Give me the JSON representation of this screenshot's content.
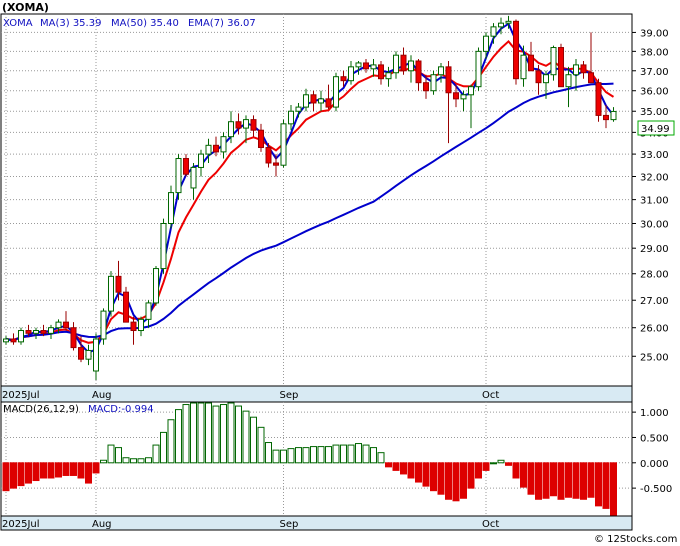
{
  "chart_data": [
    {
      "type": "candlestick",
      "title": "(XOMA)",
      "legend": [
        {
          "label": "XOMA",
          "color": "#0000cc"
        },
        {
          "label": "MA(3)",
          "value": "35.39",
          "color": "#0000cc"
        },
        {
          "label": "MA(50)",
          "value": "35.40",
          "color": "#0000cc"
        },
        {
          "label": "EMA(7)",
          "value": "36.07",
          "color": "#0000cc"
        }
      ],
      "x_ticks": [
        "2025Jul",
        "Aug",
        "Sep",
        "Oct"
      ],
      "y_ticks": [
        "25.00",
        "26.00",
        "27.00",
        "28.00",
        "29.00",
        "30.00",
        "31.00",
        "32.00",
        "33.00",
        "34.00",
        "35.00",
        "36.00",
        "37.00",
        "38.00",
        "39.00"
      ],
      "ylim": [
        24,
        40
      ],
      "y_scale": "log",
      "last_price": "34.99",
      "grid": true,
      "candles": [
        [
          25.5,
          25.7,
          25.4,
          25.6
        ],
        [
          25.6,
          25.8,
          25.4,
          25.5
        ],
        [
          25.5,
          26.0,
          25.4,
          25.9
        ],
        [
          25.9,
          26.1,
          25.7,
          25.8
        ],
        [
          25.8,
          26.0,
          25.6,
          25.9
        ],
        [
          25.9,
          26.1,
          25.7,
          25.8
        ],
        [
          25.8,
          26.1,
          25.6,
          26.0
        ],
        [
          26.0,
          26.3,
          25.8,
          26.2
        ],
        [
          26.2,
          26.6,
          25.9,
          26.0
        ],
        [
          26.0,
          26.2,
          25.2,
          25.3
        ],
        [
          25.3,
          25.7,
          24.8,
          24.9
        ],
        [
          24.9,
          25.4,
          24.7,
          25.2
        ],
        [
          24.5,
          25.8,
          24.2,
          25.6
        ],
        [
          25.6,
          26.7,
          25.4,
          26.6
        ],
        [
          26.6,
          28.1,
          26.4,
          27.9
        ],
        [
          27.9,
          28.5,
          27.0,
          27.3
        ],
        [
          27.3,
          27.5,
          26.4,
          26.2
        ],
        [
          26.2,
          26.4,
          25.4,
          25.9
        ],
        [
          25.9,
          26.4,
          25.7,
          26.3
        ],
        [
          26.3,
          27.0,
          26.0,
          26.9
        ],
        [
          26.9,
          28.3,
          26.8,
          28.2
        ],
        [
          28.2,
          30.2,
          28.0,
          30.0
        ],
        [
          30.0,
          31.6,
          29.8,
          31.3
        ],
        [
          31.3,
          33.0,
          31.0,
          32.8
        ],
        [
          32.8,
          33.0,
          32.0,
          32.1
        ],
        [
          31.5,
          32.6,
          31.0,
          32.4
        ],
        [
          32.4,
          33.2,
          32.0,
          33.0
        ],
        [
          33.0,
          33.7,
          32.6,
          33.4
        ],
        [
          33.4,
          33.8,
          32.9,
          33.1
        ],
        [
          33.1,
          34.0,
          32.8,
          33.8
        ],
        [
          33.8,
          35.0,
          33.5,
          34.5
        ],
        [
          34.5,
          34.9,
          33.9,
          34.2
        ],
        [
          34.2,
          34.8,
          33.5,
          34.6
        ],
        [
          34.6,
          34.8,
          33.8,
          34.1
        ],
        [
          34.1,
          34.4,
          33.1,
          33.3
        ],
        [
          33.3,
          33.5,
          32.4,
          32.6
        ],
        [
          32.6,
          33.0,
          32.0,
          32.5
        ],
        [
          32.5,
          34.6,
          32.4,
          34.4
        ],
        [
          34.4,
          35.3,
          34.1,
          35.0
        ],
        [
          35.0,
          35.4,
          34.7,
          35.2
        ],
        [
          35.2,
          36.1,
          35.0,
          35.8
        ],
        [
          35.8,
          36.0,
          35.0,
          35.4
        ],
        [
          35.4,
          36.0,
          35.0,
          35.6
        ],
        [
          35.6,
          36.3,
          35.1,
          35.2
        ],
        [
          35.2,
          36.9,
          35.0,
          36.7
        ],
        [
          36.7,
          37.0,
          36.2,
          36.5
        ],
        [
          36.5,
          37.5,
          36.3,
          37.2
        ],
        [
          37.2,
          37.5,
          36.8,
          37.4
        ],
        [
          37.4,
          37.6,
          36.9,
          37.1
        ],
        [
          37.1,
          37.6,
          36.7,
          37.3
        ],
        [
          37.3,
          37.5,
          36.3,
          36.6
        ],
        [
          36.6,
          37.2,
          36.2,
          36.9
        ],
        [
          36.9,
          38.0,
          36.6,
          37.8
        ],
        [
          37.8,
          38.2,
          36.8,
          37.0
        ],
        [
          37.0,
          37.8,
          36.4,
          37.5
        ],
        [
          37.5,
          37.6,
          36.0,
          36.4
        ],
        [
          36.4,
          36.8,
          35.6,
          36.0
        ],
        [
          36.0,
          37.0,
          35.8,
          36.8
        ],
        [
          36.8,
          37.4,
          36.4,
          37.2
        ],
        [
          37.2,
          37.5,
          33.5,
          35.9
        ],
        [
          35.9,
          36.3,
          35.2,
          35.6
        ],
        [
          35.6,
          36.0,
          35.0,
          35.8
        ],
        [
          35.8,
          36.3,
          34.2,
          36.2
        ],
        [
          36.2,
          38.2,
          36.0,
          38.0
        ],
        [
          38.0,
          39.0,
          37.6,
          38.8
        ],
        [
          38.8,
          39.5,
          38.4,
          39.3
        ],
        [
          39.3,
          39.8,
          38.9,
          39.5
        ],
        [
          39.5,
          39.9,
          39.2,
          39.6
        ],
        [
          39.6,
          39.7,
          36.3,
          36.6
        ],
        [
          36.6,
          38.3,
          36.2,
          37.8
        ],
        [
          37.8,
          38.5,
          37.2,
          37.0
        ],
        [
          37.0,
          37.3,
          35.8,
          36.4
        ],
        [
          36.4,
          37.0,
          35.6,
          36.8
        ],
        [
          36.8,
          38.3,
          36.5,
          38.2
        ],
        [
          38.2,
          38.4,
          36.4,
          36.2
        ],
        [
          36.2,
          37.2,
          35.2,
          36.8
        ],
        [
          36.8,
          37.6,
          36.0,
          37.3
        ],
        [
          37.3,
          37.5,
          36.6,
          36.9
        ],
        [
          36.9,
          39.0,
          36.4,
          36.4
        ],
        [
          36.4,
          36.6,
          34.5,
          34.8
        ],
        [
          34.8,
          35.3,
          34.2,
          34.6
        ],
        [
          34.6,
          35.2,
          34.5,
          34.99
        ]
      ]
    },
    {
      "type": "bar",
      "title": "MACD(26,12,9)",
      "legend": [
        {
          "label": "MACD:",
          "value": "-0.994",
          "color": "#0000cc"
        }
      ],
      "x_ticks": [
        "2025Jul",
        "Aug",
        "Sep",
        "Oct"
      ],
      "y_ticks": [
        "1.000",
        "0.500",
        "0.000",
        "-0.500"
      ],
      "ylim": [
        -1.05,
        1.2
      ],
      "grid": true,
      "colors": {
        "positive": "#006600",
        "negative": "#dd0000"
      },
      "values": [
        -0.55,
        -0.5,
        -0.45,
        -0.4,
        -0.35,
        -0.3,
        -0.3,
        -0.28,
        -0.25,
        -0.25,
        -0.3,
        -0.4,
        -0.2,
        0.05,
        0.35,
        0.3,
        0.1,
        0.08,
        0.08,
        0.1,
        0.35,
        0.6,
        0.85,
        1.05,
        1.15,
        1.18,
        1.18,
        1.18,
        1.12,
        1.15,
        1.18,
        1.12,
        1.02,
        0.9,
        0.7,
        0.4,
        0.25,
        0.25,
        0.28,
        0.3,
        0.3,
        0.32,
        0.32,
        0.32,
        0.35,
        0.35,
        0.35,
        0.38,
        0.35,
        0.3,
        0.2,
        -0.08,
        -0.15,
        -0.22,
        -0.3,
        -0.38,
        -0.46,
        -0.55,
        -0.62,
        -0.72,
        -0.75,
        -0.7,
        -0.5,
        -0.3,
        -0.15,
        0.0,
        0.05,
        -0.05,
        -0.3,
        -0.48,
        -0.62,
        -0.72,
        -0.7,
        -0.65,
        -0.72,
        -0.68,
        -0.7,
        -0.72,
        -0.68,
        -0.85,
        -0.9,
        -1.05
      ]
    }
  ],
  "footer": "© 12Stocks.com"
}
